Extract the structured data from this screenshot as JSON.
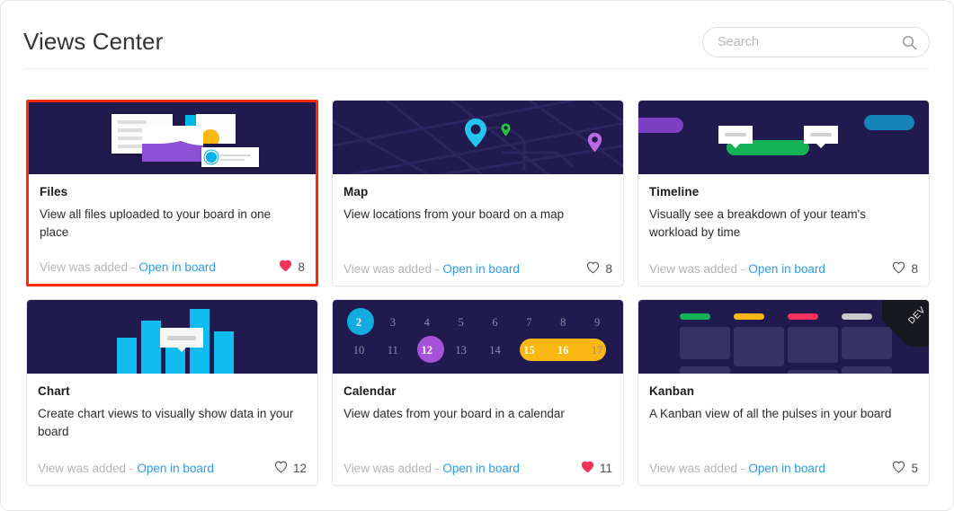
{
  "header": {
    "title": "Views Center",
    "search": {
      "placeholder": "Search",
      "value": "",
      "icon": "search-icon"
    }
  },
  "colors": {
    "thumb_bg": "#201a4e",
    "selection_border": "#fa2a0b",
    "link": "#2a9cf0",
    "liked_heart": "#f5325b",
    "unliked_heart": "#4d4d4d",
    "cyan": "#0fbbef",
    "purple": "#8d4fd6",
    "green": "#14b257",
    "yellow": "#fbb814",
    "red": "#f5325b",
    "gray": "#c9c9c9"
  },
  "cards": [
    {
      "id": "files",
      "title": "Files",
      "description": "View all files uploaded to your board in one place",
      "status": "View was added -",
      "link": "Open in board",
      "likes": 8,
      "liked": true,
      "selected": true,
      "thumbnail": "files-illustration"
    },
    {
      "id": "map",
      "title": "Map",
      "description": "View locations from your board on a map",
      "status": "View was added -",
      "link": "Open in board",
      "likes": 8,
      "liked": false,
      "selected": false,
      "thumbnail": "map-illustration"
    },
    {
      "id": "timeline",
      "title": "Timeline",
      "description": "Visually see a breakdown of your team's workload by time",
      "status": "View was added -",
      "link": "Open in board",
      "likes": 8,
      "liked": false,
      "selected": false,
      "thumbnail": "timeline-illustration"
    },
    {
      "id": "chart",
      "title": "Chart",
      "description": "Create chart views to visually show data in your board",
      "status": "View was added -",
      "link": "Open in board",
      "likes": 12,
      "liked": false,
      "selected": false,
      "thumbnail": "chart-illustration"
    },
    {
      "id": "calendar",
      "title": "Calendar",
      "description": "View dates from your board in a calendar",
      "status": "View was added -",
      "link": "Open in board",
      "likes": 11,
      "liked": true,
      "selected": false,
      "thumbnail": "calendar-illustration"
    },
    {
      "id": "kanban",
      "title": "Kanban",
      "description": "A Kanban view of all the pulses in your board",
      "status": "View was added -",
      "link": "Open in board",
      "likes": 5,
      "liked": false,
      "selected": false,
      "thumbnail": "kanban-illustration",
      "ribbon": "DEV"
    }
  ],
  "calendar_thumb": {
    "row1": [
      "2",
      "3",
      "4",
      "5",
      "6",
      "7",
      "8",
      "9"
    ],
    "row2": [
      "10",
      "11",
      "12",
      "13",
      "14",
      "15",
      "16",
      "17"
    ],
    "highlights": [
      {
        "day": "2",
        "style": "circle",
        "color": "#11abe2"
      },
      {
        "day": "12",
        "style": "circle",
        "color": "#a552d8"
      },
      {
        "day": "15-16",
        "style": "pill",
        "color": "#fbb814"
      }
    ]
  },
  "chart_thumb": {
    "type": "bar",
    "values": [
      48,
      72,
      40,
      88,
      56
    ],
    "color": "#0fbbef"
  },
  "kanban_thumb": {
    "column_colors": [
      "#14b257",
      "#fbb814",
      "#f5325b",
      "#c9c9c9"
    ]
  },
  "timeline_thumb": {
    "bars": [
      {
        "color": "#7b3fc4",
        "label": "purple-bar"
      },
      {
        "color": "#14b257",
        "label": "green-bar"
      },
      {
        "color": "#1683b8",
        "label": "blue-bar"
      }
    ]
  },
  "map_thumb": {
    "pins": [
      {
        "color": "#20c6ef",
        "size": "large"
      },
      {
        "color": "#25c440",
        "size": "small"
      },
      {
        "color": "#b96ae0",
        "size": "medium"
      }
    ]
  }
}
